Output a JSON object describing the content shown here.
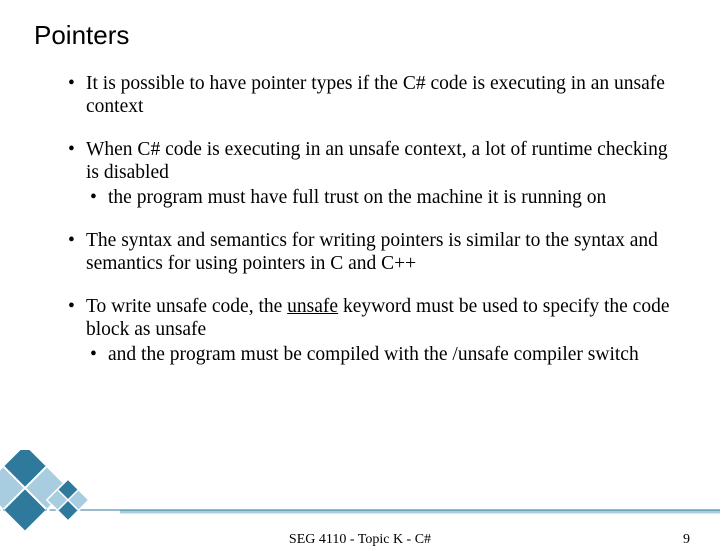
{
  "title": "Pointers",
  "bullets": {
    "b1": {
      "text": "It is possible to have pointer types if the C# code is executing in an unsafe context"
    },
    "b2": {
      "text": "When C# code is executing in an unsafe context, a lot of runtime checking is disabled",
      "sub": "the program must have full trust on the machine it is running on"
    },
    "b3": {
      "text": "The syntax and semantics for writing pointers is similar to the syntax and semantics for using pointers in C and C++"
    },
    "b4": {
      "pre": "To write unsafe code, the ",
      "underline": "unsafe",
      "post": " keyword must be used to specify the code block as unsafe",
      "sub": "and the program must be compiled with the /unsafe compiler switch"
    }
  },
  "footer": {
    "center": "SEG 4110 - Topic K - C#",
    "page": "9"
  },
  "colors": {
    "accent": "#2f7a9c",
    "accent_light": "#a9cde0"
  }
}
